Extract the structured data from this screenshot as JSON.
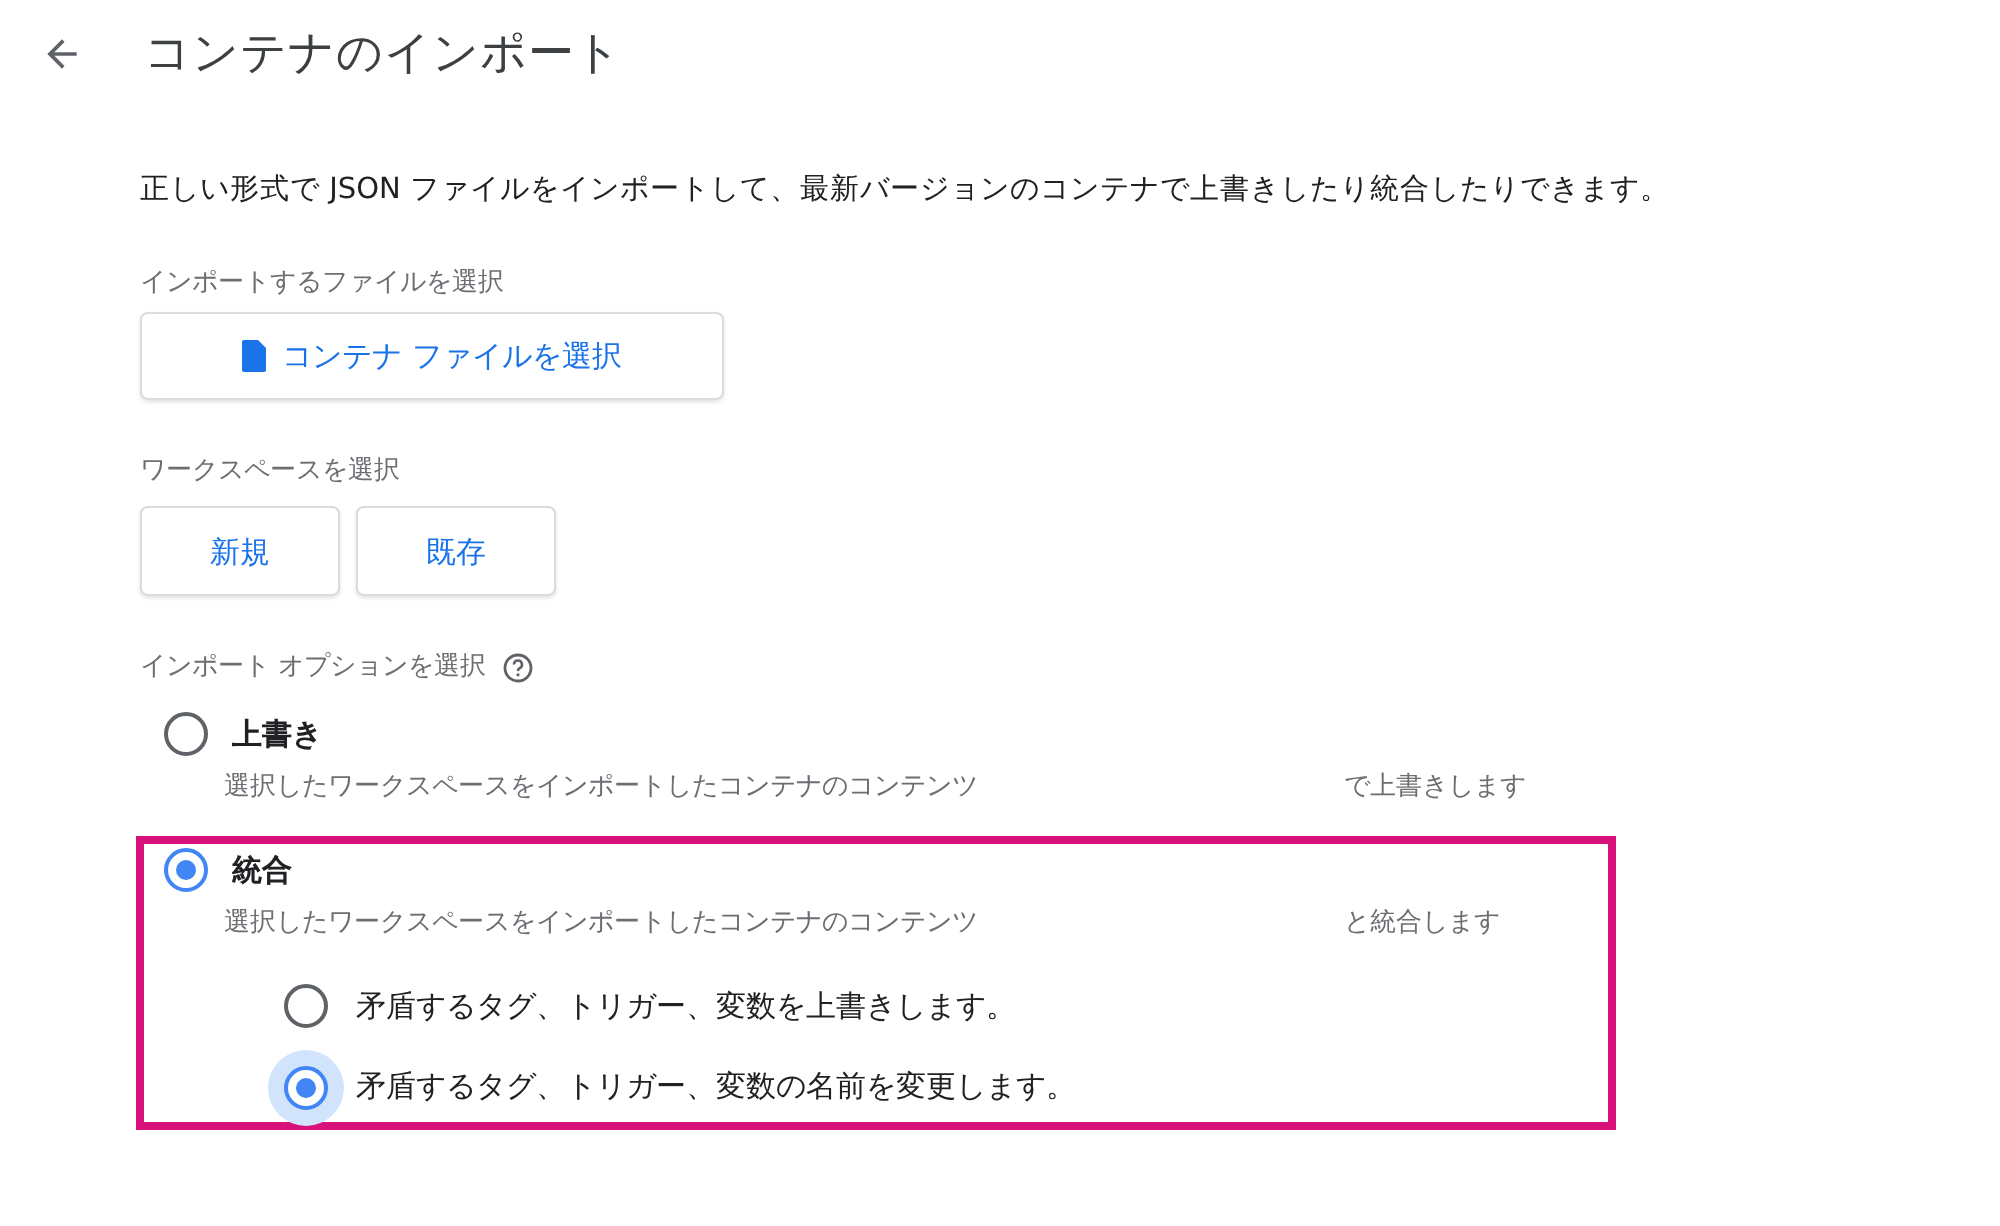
{
  "header": {
    "title": "コンテナのインポート"
  },
  "intro": "正しい形式で JSON ファイルをインポートして、最新バージョンのコンテナで上書きしたり統合したりできます。",
  "file_section": {
    "label": "インポートするファイルを選択",
    "button": "コンテナ ファイルを選択"
  },
  "workspace_section": {
    "label": "ワークスペースを選択",
    "buttons": [
      "新規",
      "既存"
    ]
  },
  "options_section": {
    "label": "インポート オプションを選択",
    "options": [
      {
        "label": "上書き",
        "selected": false,
        "highlighted": false,
        "description": [
          "選択したワークスペースをインポートしたコンテナのコンテンツ",
          "で上書きします"
        ]
      },
      {
        "label": "統合",
        "selected": true,
        "highlighted": true,
        "description": [
          "選択したワークスペースをインポートしたコンテナのコンテンツ",
          "と統合します"
        ],
        "sub_options": [
          {
            "label": "矛盾するタグ、トリガー、変数を上書きします。",
            "selected": false
          },
          {
            "label": "矛盾するタグ、トリガー、変数の名前を変更します。",
            "selected": true
          }
        ]
      }
    ]
  }
}
